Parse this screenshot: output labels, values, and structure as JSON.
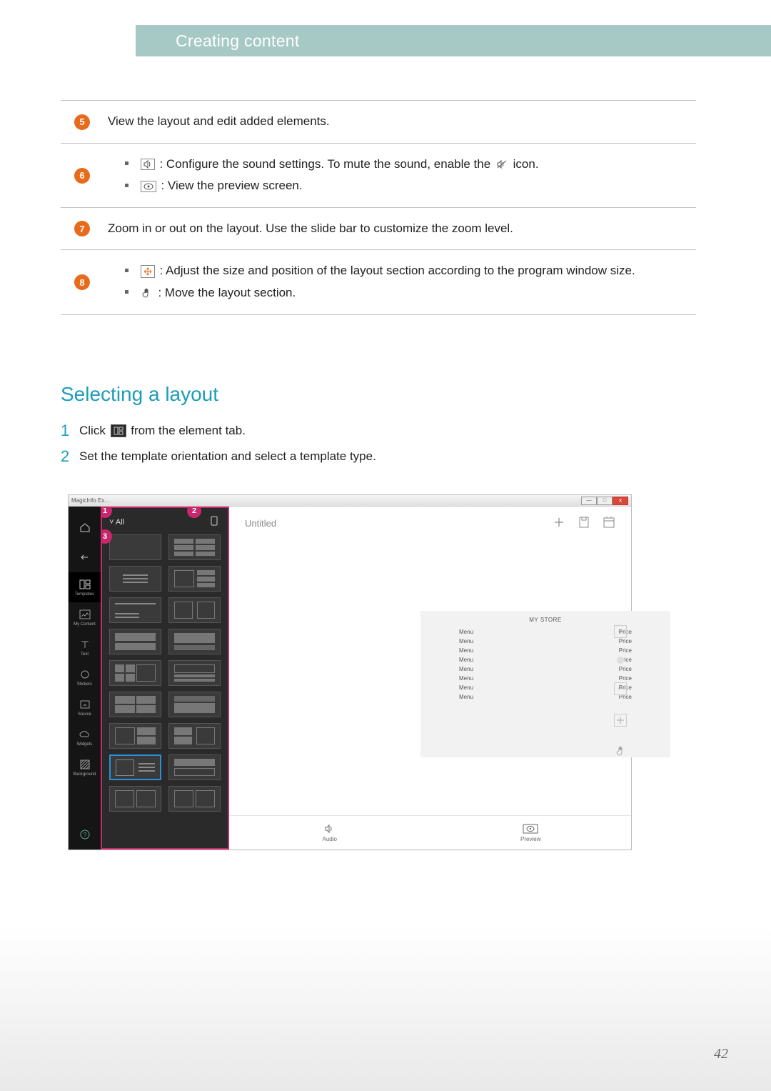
{
  "header": {
    "title": "Creating content"
  },
  "legend": {
    "5": "View the layout and edit added elements.",
    "6a": ": Configure the sound settings. To mute the sound, enable the ",
    "6a_end": " icon.",
    "6b": ": View the preview screen.",
    "7": "Zoom in or out on the layout. Use the slide bar to customize the zoom level.",
    "8a": ": Adjust the size and position of the layout section according to the program window size.",
    "8b": ": Move the layout section."
  },
  "section": {
    "title": "Selecting a layout"
  },
  "steps": {
    "1a": "Click ",
    "1b": " from the element tab.",
    "2": "Set the template orientation and select a template type."
  },
  "shot": {
    "app_title": "MagicInfo Ex...",
    "all": "All",
    "untitled": "Untitled",
    "sidebar": {
      "templates": "Templates",
      "mycontent": "My Content",
      "text": "Text",
      "stickers": "Stickers",
      "source": "Source",
      "widgets": "Widgets",
      "background": "Background"
    },
    "menu": {
      "title": "MY STORE",
      "menu": "Menu",
      "price": "Price"
    },
    "bottom": {
      "audio": "Audio",
      "preview": "Preview"
    }
  },
  "page": "42"
}
